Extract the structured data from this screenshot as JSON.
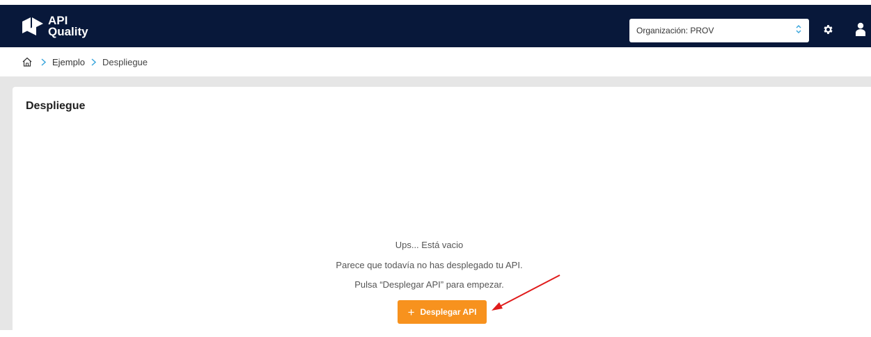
{
  "header": {
    "logo_line1": "API",
    "logo_line2": "Quality",
    "organization_value": "Organización: PROV",
    "icons": [
      "settings-icon",
      "user-icon"
    ]
  },
  "breadcrumb": {
    "home_icon": "home-icon",
    "items": [
      "Ejemplo",
      "Despliegue"
    ]
  },
  "page": {
    "title": "Despliegue",
    "empty_title": "Ups... Está vacio",
    "empty_line1": "Parece que todavía no has desplegado tu API.",
    "empty_line2": "Pulsa “Desplegar API” para empezar.",
    "deploy_button_label": "Desplegar API"
  },
  "colors": {
    "header_bg": "#08183a",
    "accent": "#f7921e",
    "breadcrumb_chevron": "#3aa6dc",
    "annotation_arrow": "#e01b1b"
  }
}
